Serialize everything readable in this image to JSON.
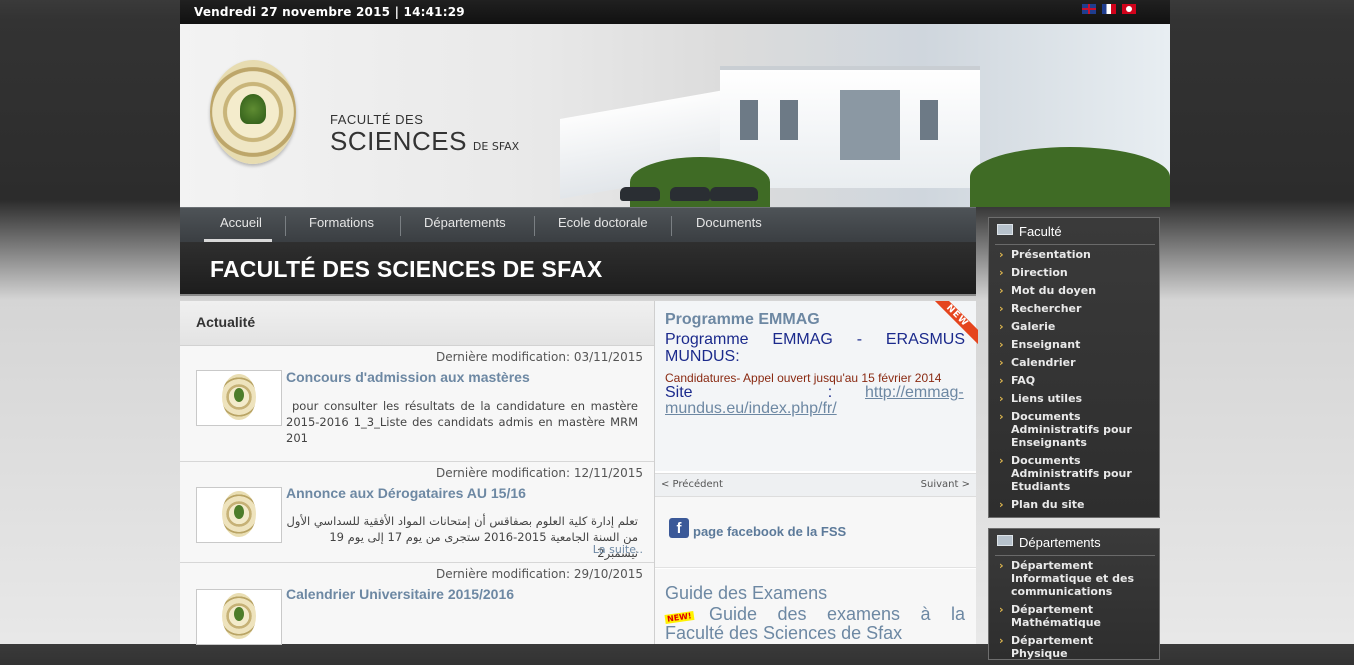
{
  "topbar": {
    "datetime": "Vendredi 27 novembre 2015  |  14:41:29",
    "flags": [
      "english-flag",
      "french-flag",
      "tunisian-flag"
    ]
  },
  "banner": {
    "brand_line1": "FACULTÉ DES",
    "brand_line2": "SCIENCES",
    "brand_line3": "DE SFAX"
  },
  "nav": {
    "items": [
      "Accueil",
      "Formations",
      "Départements",
      "Ecole doctorale",
      "Documents"
    ]
  },
  "page_title": "FACULTÉ DES SCIENCES DE SFAX",
  "news": {
    "heading": "Actualité",
    "items": [
      {
        "modified": "Dernière modification: 03/11/2015",
        "title": "Concours d'admission aux mastères",
        "text": "pour consulter les résultats de la candidature en mastère 2015-2016   1_3_Liste des candidats admis en mastère MRM 201"
      },
      {
        "modified": "Dernière modification: 12/11/2015",
        "title": "Annonce aux Dérogataires AU 15/16",
        "text": "تعلم إدارة كلية العلوم بصفاقس أن إمتحانات المواد الأفقية للسداسي الأول من السنة الجامعية 2015-2016 ستجرى من يوم 17 إلى يوم 19 نيسمبر2",
        "more": "La suite.."
      },
      {
        "modified": "Dernière modification: 29/10/2015",
        "title": "Calendrier Universitaire 2015/2016"
      }
    ]
  },
  "emmag": {
    "badge": "NEW",
    "heading": "Programme EMMAG",
    "line1": "Programme EMMAG - ERASMUS",
    "line1b": "MUNDUS:",
    "candidatures": "Candidatures- Appel ouvert jusqu'au 15 février 2014",
    "site_label": "Site",
    "site_colon": ":",
    "site_link": "http://emmag-mundus.eu/index.php/fr/"
  },
  "pager": {
    "prev": "< Précédent",
    "next": "Suivant >"
  },
  "facebook": {
    "icon_letter": "f",
    "label": "page facebook de la FSS"
  },
  "guide": {
    "heading": "Guide des Examens",
    "new_badge": "NEW!",
    "text": "Guide des examens à la Faculté des Sciences de Sfax"
  },
  "sidebar": {
    "faculte": {
      "title": "Faculté",
      "items": [
        "Présentation",
        "Direction",
        "Mot du doyen",
        "Rechercher",
        "Galerie",
        "Enseignant",
        "Calendrier",
        "FAQ",
        "Liens utiles",
        "Documents Administratifs pour Enseignants",
        "Documents Administratifs pour Etudiants",
        "Plan du site"
      ]
    },
    "departements": {
      "title": "Départements",
      "items": [
        "Département Informatique et des communications",
        "Département Mathématique",
        "Département Physique"
      ]
    }
  }
}
